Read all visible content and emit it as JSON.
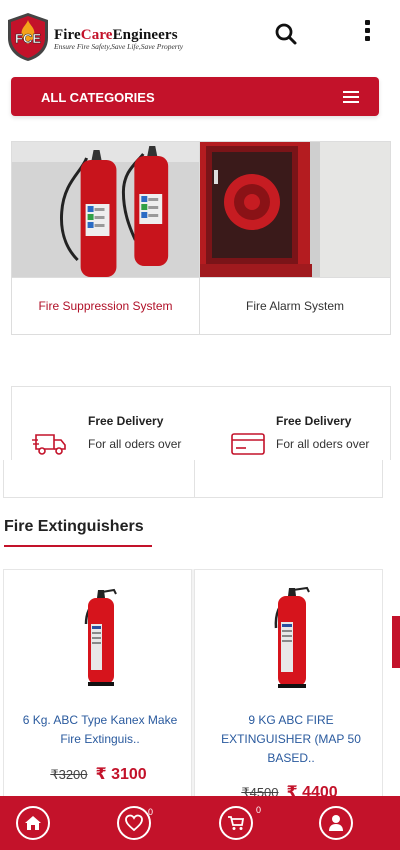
{
  "header": {
    "brand_prefix": "Fire",
    "brand_accent": "Care",
    "brand_suffix": "Engineers",
    "tagline": "Ensure Fire Safety,Save Life,Save Property",
    "logo_text": "FCE",
    "search_icon": "search-icon",
    "menu_icon": "more-vertical-icon"
  },
  "categories_bar": {
    "label": "ALL CATEGORIES",
    "icon": "hamburger-icon"
  },
  "categories": [
    {
      "label": "Fire Suppression System"
    },
    {
      "label": "Fire Alarm System"
    }
  ],
  "features": [
    {
      "title": "Free Delivery",
      "subtitle": "For all oders over",
      "icon": "delivery-truck-icon"
    },
    {
      "title": "Free Delivery",
      "subtitle": "For all oders over",
      "icon": "credit-card-icon"
    }
  ],
  "section": {
    "title": "Fire Extinguishers"
  },
  "products": [
    {
      "name": "6 Kg. ABC Type Kanex Make Fire Extinguis..",
      "old_price": "₹3200",
      "price": "₹ 3100"
    },
    {
      "name": "9 KG ABC FIRE EXTINGUISHER (MAP 50 BASED..",
      "old_price": "₹4500",
      "price": "₹ 4400"
    }
  ],
  "bottom_nav": {
    "wishlist_count": "0",
    "cart_count": "0"
  },
  "colors": {
    "brand_red": "#c3122a",
    "link_blue": "#2a5a9e"
  }
}
